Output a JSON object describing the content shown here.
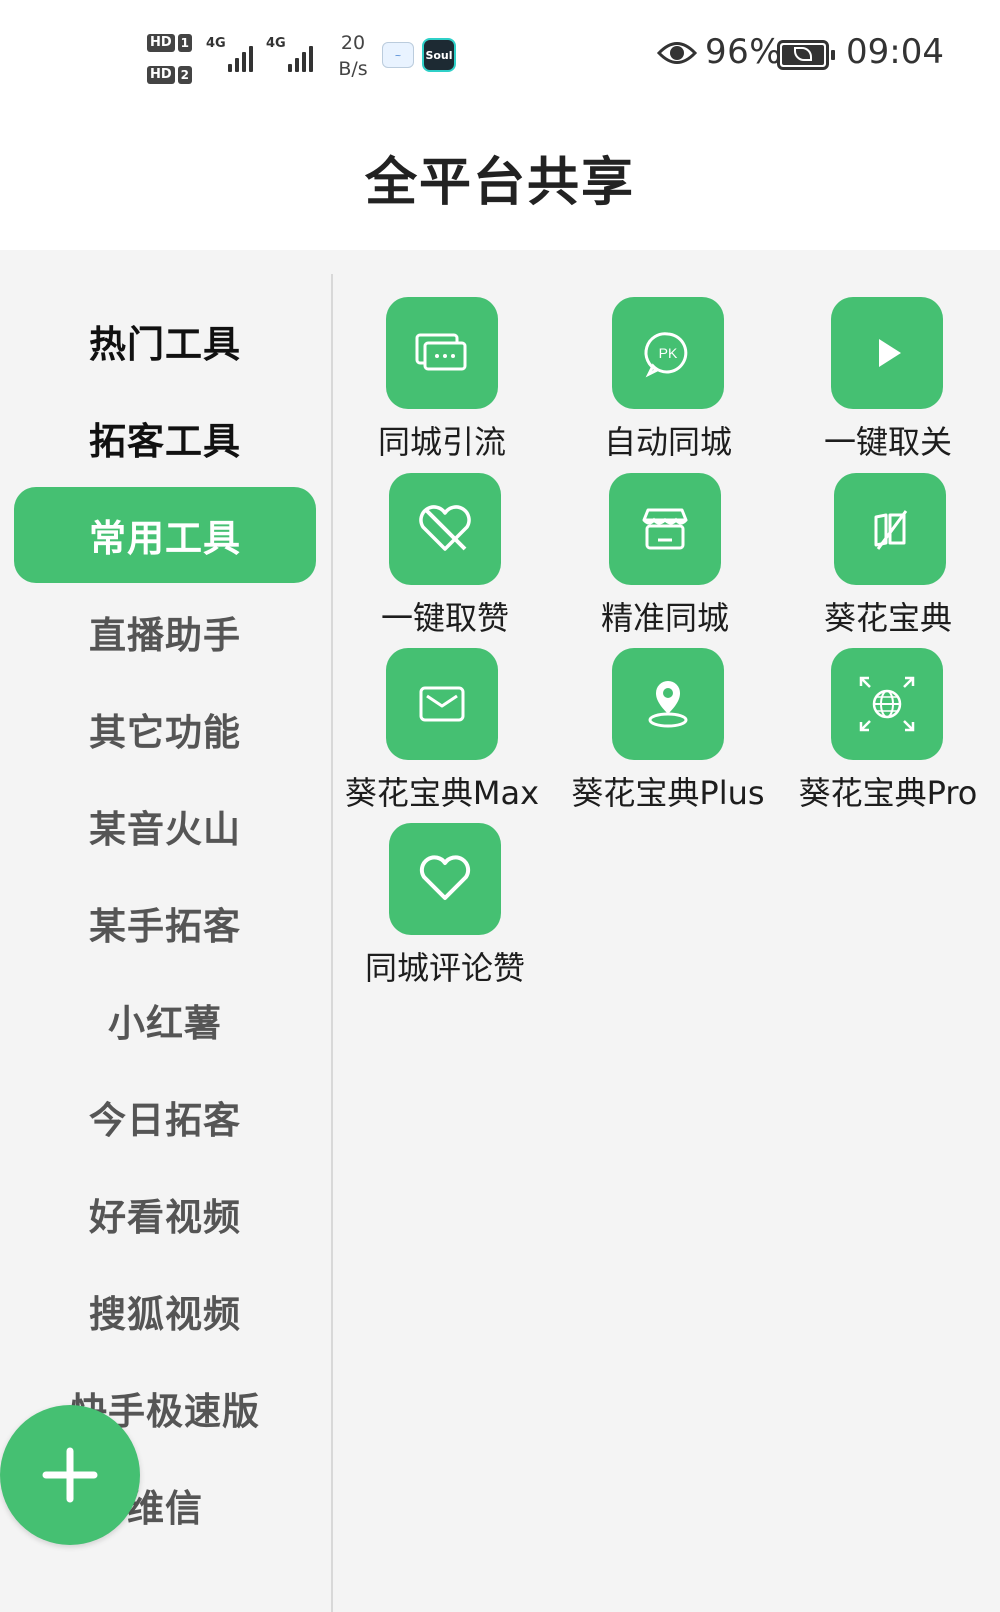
{
  "status_bar": {
    "hd1": "HD",
    "sim1": "1",
    "hd2": "HD",
    "sim2": "2",
    "net1": "4G",
    "net2": "4G",
    "speed_value": "20",
    "speed_unit": "B/s",
    "app_icon_1": "app-icon",
    "app_icon_2": "Soul",
    "battery_percent": "96%",
    "time": "09:04"
  },
  "header": {
    "title": "全平台共享"
  },
  "sidebar": {
    "items": [
      {
        "label": "热门工具"
      },
      {
        "label": "拓客工具"
      },
      {
        "label": "常用工具",
        "active": true
      },
      {
        "label": "直播助手"
      },
      {
        "label": "其它功能"
      },
      {
        "label": "某音火山"
      },
      {
        "label": "某手拓客"
      },
      {
        "label": "小红薯"
      },
      {
        "label": "今日拓客"
      },
      {
        "label": "好看视频"
      },
      {
        "label": "搜狐视频"
      },
      {
        "label": "快手极速版"
      },
      {
        "label": "维信"
      }
    ]
  },
  "tools": [
    {
      "label": "同城引流",
      "icon": "chat-bubbles-icon"
    },
    {
      "label": "自动同城",
      "icon": "pk-icon"
    },
    {
      "label": "一键取关",
      "icon": "play-icon"
    },
    {
      "label": "一键取赞",
      "icon": "broken-heart-icon"
    },
    {
      "label": "精准同城",
      "icon": "store-icon"
    },
    {
      "label": "葵花宝典",
      "icon": "book-icon"
    },
    {
      "label": "葵花宝典Max",
      "icon": "mail-icon"
    },
    {
      "label": "葵花宝典Plus",
      "icon": "location-pin-icon"
    },
    {
      "label": "葵花宝典Pro",
      "icon": "globe-expand-icon"
    },
    {
      "label": "同城评论赞",
      "icon": "heart-icon"
    }
  ],
  "fab": {
    "icon": "plus-icon"
  },
  "colors": {
    "accent": "#45c072",
    "background": "#f4f4f4"
  }
}
